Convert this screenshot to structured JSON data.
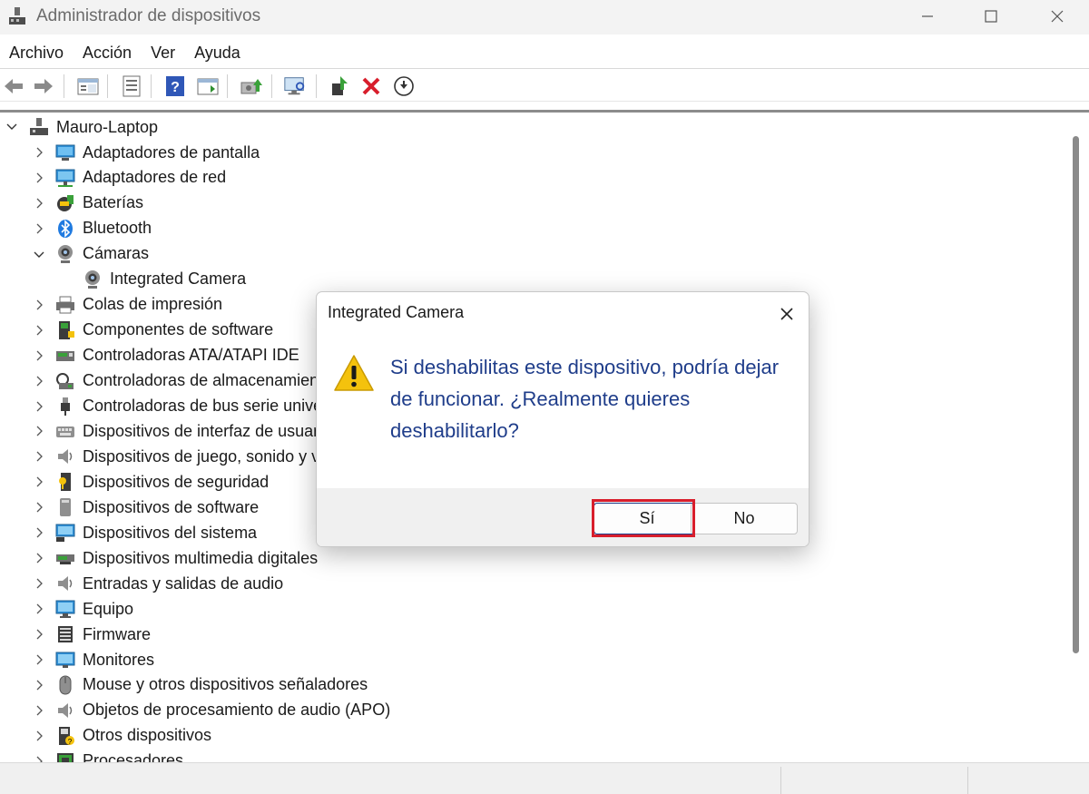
{
  "window": {
    "title": "Administrador de dispositivos"
  },
  "menu": [
    "Archivo",
    "Acción",
    "Ver",
    "Ayuda"
  ],
  "tree": {
    "root": "Mauro-Laptop",
    "items": [
      {
        "label": "Adaptadores de pantalla",
        "icon": "display-adapter-icon",
        "expanded": false
      },
      {
        "label": "Adaptadores de red",
        "icon": "network-adapter-icon",
        "expanded": false
      },
      {
        "label": "Baterías",
        "icon": "battery-icon",
        "expanded": false
      },
      {
        "label": "Bluetooth",
        "icon": "bluetooth-icon",
        "expanded": false
      },
      {
        "label": "Cámaras",
        "icon": "camera-icon",
        "expanded": true
      },
      {
        "label": "Integrated Camera",
        "icon": "camera-icon",
        "child": true
      },
      {
        "label": "Colas de impresión",
        "icon": "printer-icon",
        "expanded": false
      },
      {
        "label": "Componentes de software",
        "icon": "software-component-icon",
        "expanded": false
      },
      {
        "label": "Controladoras ATA/ATAPI IDE",
        "icon": "ide-controller-icon",
        "expanded": false
      },
      {
        "label": "Controladoras de almacenamiento",
        "icon": "storage-controller-icon",
        "expanded": false
      },
      {
        "label": "Controladoras de bus serie universal",
        "icon": "usb-icon",
        "expanded": false
      },
      {
        "label": "Dispositivos de interfaz de usuario (HID)",
        "icon": "keyboard-icon",
        "expanded": false
      },
      {
        "label": "Dispositivos de juego, sonido y vídeo",
        "icon": "speaker-icon",
        "expanded": false
      },
      {
        "label": "Dispositivos de seguridad",
        "icon": "security-device-icon",
        "expanded": false
      },
      {
        "label": "Dispositivos de software",
        "icon": "software-device-icon",
        "expanded": false
      },
      {
        "label": "Dispositivos del sistema",
        "icon": "system-device-icon",
        "expanded": false
      },
      {
        "label": "Dispositivos multimedia digitales",
        "icon": "multimedia-device-icon",
        "expanded": false
      },
      {
        "label": "Entradas y salidas de audio",
        "icon": "speaker-icon",
        "expanded": false
      },
      {
        "label": "Equipo",
        "icon": "computer-icon",
        "expanded": false
      },
      {
        "label": "Firmware",
        "icon": "firmware-icon",
        "expanded": false
      },
      {
        "label": "Monitores",
        "icon": "monitor-icon",
        "expanded": false
      },
      {
        "label": "Mouse y otros dispositivos señaladores",
        "icon": "mouse-icon",
        "expanded": false
      },
      {
        "label": "Objetos de procesamiento de audio (APO)",
        "icon": "speaker-icon",
        "expanded": false
      },
      {
        "label": "Otros dispositivos",
        "icon": "other-device-icon",
        "expanded": false
      },
      {
        "label": "Procesadores",
        "icon": "processor-icon",
        "expanded": false
      }
    ]
  },
  "dialog": {
    "title": "Integrated Camera",
    "message": "Si deshabilitas este dispositivo, podría dejar de funcionar. ¿Realmente quieres deshabilitarlo?",
    "yes_label": "Sí",
    "no_label": "No"
  },
  "colors": {
    "message": "#1f3d8a",
    "highlight": "#d81e2c",
    "warning": "#f4c20d"
  }
}
